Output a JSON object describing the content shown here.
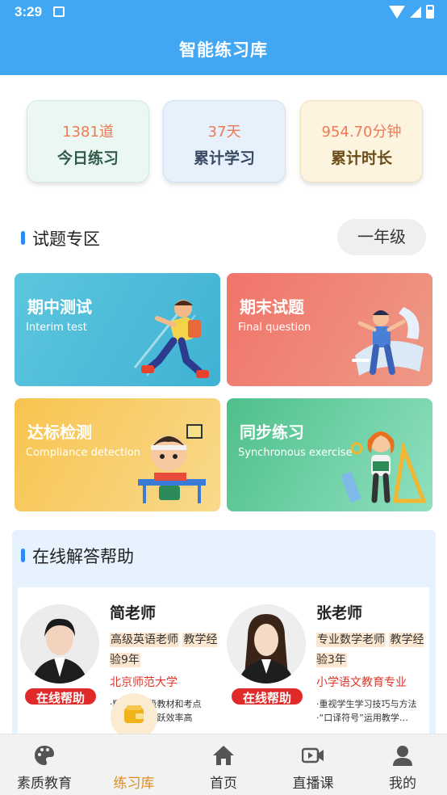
{
  "status_bar": {
    "time": "3:29"
  },
  "header": {
    "title": "智能练习库"
  },
  "stats": [
    {
      "value": "1381道",
      "label": "今日练习"
    },
    {
      "value": "37天",
      "label": "累计学习"
    },
    {
      "value": "954.70分钟",
      "label": "累计时长"
    }
  ],
  "exam_section": {
    "title": "试题专区",
    "grade": "一年级"
  },
  "categories": [
    {
      "title": "期中测试",
      "subtitle": "Interim test"
    },
    {
      "title": "期末试题",
      "subtitle": "Final question"
    },
    {
      "title": "达标检测",
      "subtitle": "Compliance detection"
    },
    {
      "title": "同步练习",
      "subtitle": "Synchronous exercise"
    }
  ],
  "help_section": {
    "title": "在线解答帮助"
  },
  "teachers": [
    {
      "name": "简老师",
      "tag1": "高级英语老师",
      "tag2": "教学经验9年",
      "school": "北京师范大学",
      "desc1": "·精通各年级教材和考点",
      "desc2": "·课堂互动活跃效率高",
      "badge": "在线帮助"
    },
    {
      "name": "张老师",
      "tag1": "专业数学老师",
      "tag2": "教学经验3年",
      "school": "小学语文教育专业",
      "desc1": "·重视学生学习技巧与方法",
      "desc2": "·“口译符号”运用教学…",
      "badge": "在线帮助"
    }
  ],
  "nav": [
    {
      "label": "素质教育",
      "icon": "palette-icon"
    },
    {
      "label": "练习库",
      "icon": "wallet-icon",
      "active": true
    },
    {
      "label": "首页",
      "icon": "home-icon"
    },
    {
      "label": "直播课",
      "icon": "video-icon"
    },
    {
      "label": "我的",
      "icon": "user-icon"
    }
  ],
  "colors": {
    "primary": "#41a7f5",
    "accent": "#ee7a55",
    "active_nav": "#e08c1c",
    "badge": "#e02a2a"
  }
}
